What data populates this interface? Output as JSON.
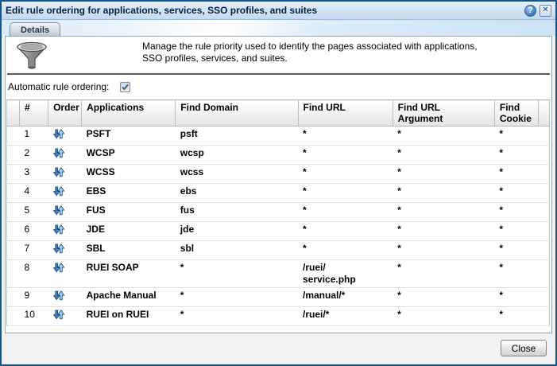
{
  "window": {
    "title": "Edit rule ordering for applications, services, SSO profiles, and suites",
    "help_icon": "?",
    "close_icon": "x"
  },
  "tabs": {
    "details_label": "Details"
  },
  "intro": {
    "icon": "funnel-icon",
    "description": "Manage the rule priority used to identify the pages associated with applications,\nSSO profiles, services, and suites."
  },
  "controls": {
    "automatic_rule_ordering_label": "Automatic rule ordering:",
    "automatic_rule_ordering_checked": true
  },
  "table": {
    "columns": [
      "#",
      "Order",
      "Applications",
      "Find Domain",
      "Find URL",
      "Find URL\nArgument",
      "Find\nCookie"
    ],
    "order_icon": "reorder-up-down-icon",
    "rows": [
      {
        "num": "1",
        "application": "PSFT",
        "find_domain": "psft",
        "find_url": "*",
        "find_url_argument": "*",
        "find_cookie": "*"
      },
      {
        "num": "2",
        "application": "WCSP",
        "find_domain": "wcsp",
        "find_url": "*",
        "find_url_argument": "*",
        "find_cookie": "*"
      },
      {
        "num": "3",
        "application": "WCSS",
        "find_domain": "wcss",
        "find_url": "*",
        "find_url_argument": "*",
        "find_cookie": "*"
      },
      {
        "num": "4",
        "application": "EBS",
        "find_domain": "ebs",
        "find_url": "*",
        "find_url_argument": "*",
        "find_cookie": "*"
      },
      {
        "num": "5",
        "application": "FUS",
        "find_domain": "fus",
        "find_url": "*",
        "find_url_argument": "*",
        "find_cookie": "*"
      },
      {
        "num": "6",
        "application": "JDE",
        "find_domain": "jde",
        "find_url": "*",
        "find_url_argument": "*",
        "find_cookie": "*"
      },
      {
        "num": "7",
        "application": "SBL",
        "find_domain": "sbl",
        "find_url": "*",
        "find_url_argument": "*",
        "find_cookie": "*"
      },
      {
        "num": "8",
        "application": "RUEI SOAP",
        "find_domain": "*",
        "find_url": "/ruei/\nservice.php",
        "find_url_argument": "*",
        "find_cookie": "*"
      },
      {
        "num": "9",
        "application": "Apache Manual",
        "find_domain": "*",
        "find_url": "/manual/*",
        "find_url_argument": "*",
        "find_cookie": "*"
      },
      {
        "num": "10",
        "application": "RUEI on RUEI",
        "find_domain": "*",
        "find_url": "/ruei/*",
        "find_url_argument": "*",
        "find_cookie": "*"
      }
    ]
  },
  "footer": {
    "close_label": "Close"
  },
  "colors": {
    "dialog_border": "#11578b",
    "titlebar_top": "#e4f0fb",
    "titlebar_bottom": "#c2d9ef",
    "order_icon_blue": "#3d7fc1",
    "order_icon_light_blue": "#a6d2f7"
  }
}
